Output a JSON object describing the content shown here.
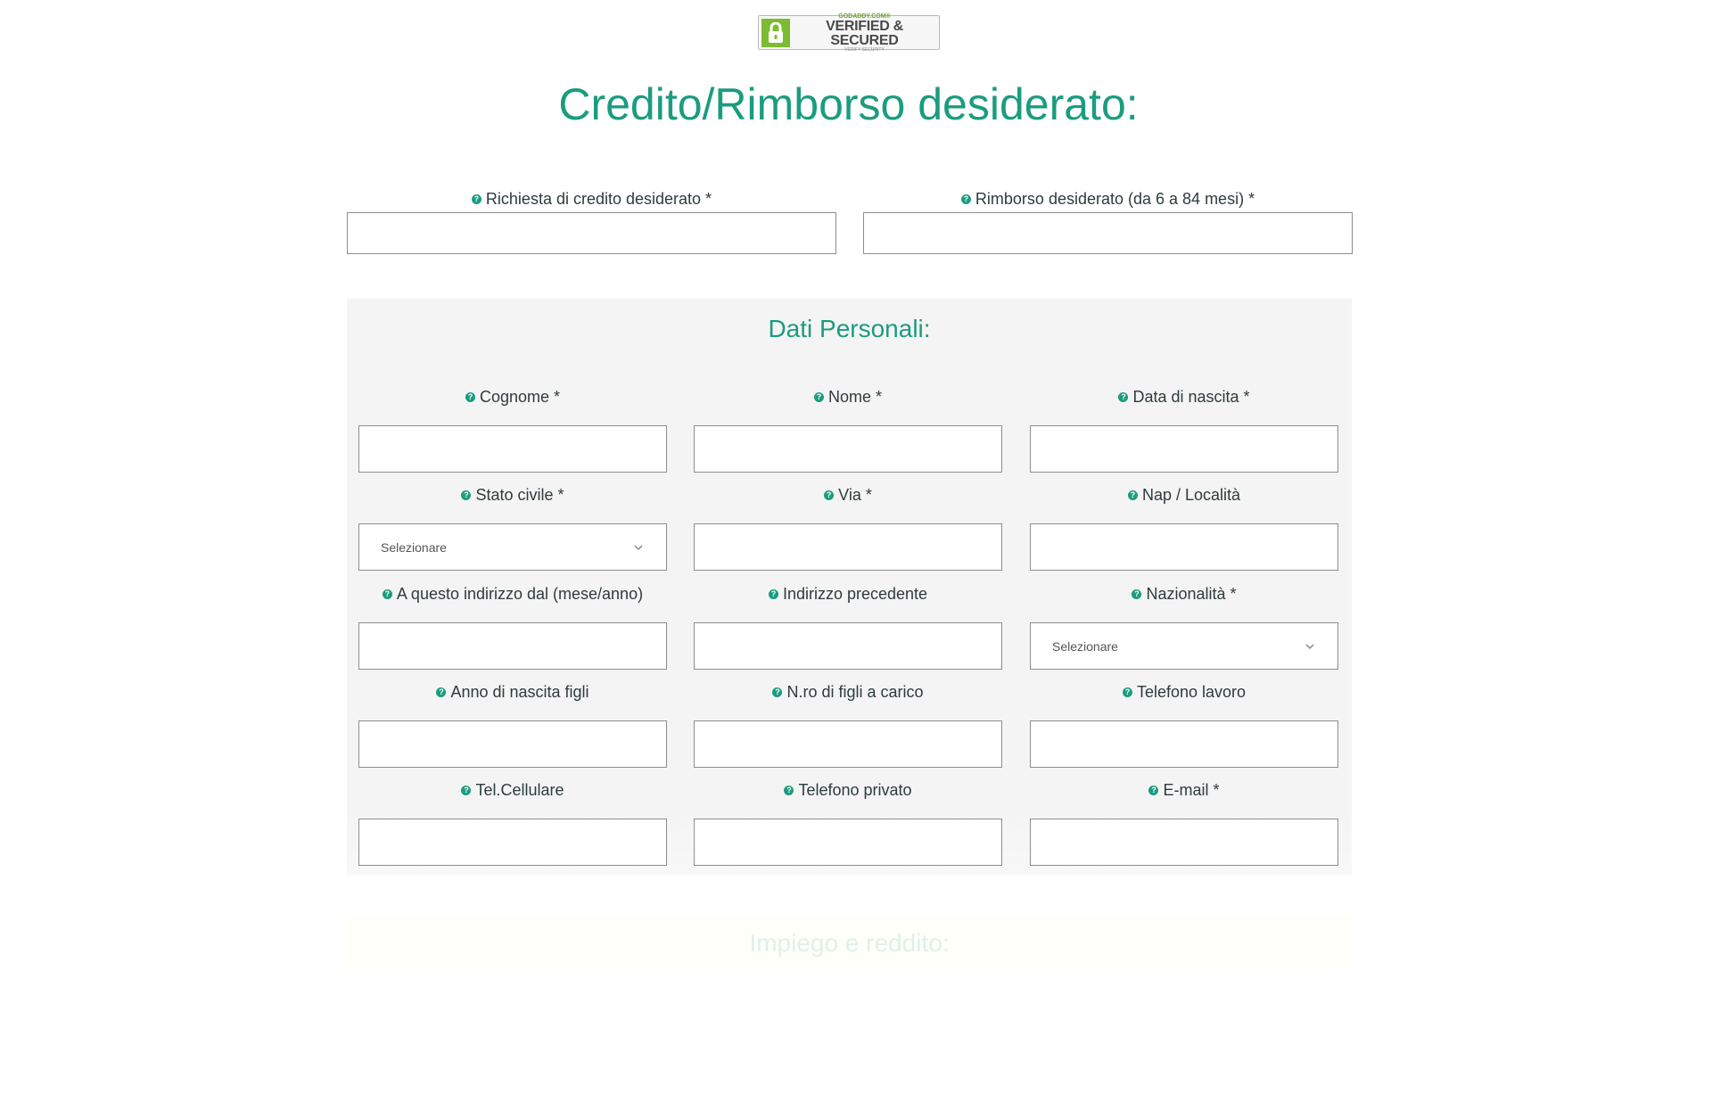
{
  "badge": {
    "small_top": "GODADDY.COM®",
    "main": "VERIFIED & SECURED",
    "small_bottom": "VERIFY SECURITY",
    "icon": "lock-icon"
  },
  "page_title": "Credito/Rimborso desiderato:",
  "top_fields": [
    {
      "label": "Richiesta di credito desiderato *",
      "value": ""
    },
    {
      "label": "Rimborso desiderato (da 6 a 84 mesi) *",
      "value": ""
    }
  ],
  "personal": {
    "title": "Dati Personali:",
    "fields": [
      {
        "label": "Cognome *",
        "type": "text",
        "value": ""
      },
      {
        "label": "Nome *",
        "type": "text",
        "value": ""
      },
      {
        "label": "Data di nascita *",
        "type": "text",
        "value": ""
      },
      {
        "label": "Stato civile *",
        "type": "select",
        "value": "Selezionare"
      },
      {
        "label": "Via *",
        "type": "text",
        "value": ""
      },
      {
        "label": "Nap / Località",
        "type": "text",
        "value": ""
      },
      {
        "label": "A questo indirizzo dal (mese/anno)",
        "type": "text",
        "value": ""
      },
      {
        "label": "Indirizzo precedente",
        "type": "text",
        "value": ""
      },
      {
        "label": "Nazionalità *",
        "type": "select",
        "value": "Selezionare"
      },
      {
        "label": "Anno di nascita figli",
        "type": "text",
        "value": ""
      },
      {
        "label": "N.ro di figli a carico",
        "type": "text",
        "value": ""
      },
      {
        "label": "Telefono lavoro",
        "type": "text",
        "value": ""
      },
      {
        "label": "Tel.Cellulare",
        "type": "text",
        "value": ""
      },
      {
        "label": "Telefono privato",
        "type": "text",
        "value": ""
      },
      {
        "label": "E-mail *",
        "type": "text",
        "value": ""
      }
    ]
  },
  "employment": {
    "title": "Impiego e reddito:"
  },
  "help_icon_glyph": "?",
  "colors": {
    "accent": "#1b9c7f",
    "panel_bg": "#f4f4f4",
    "input_border": "#8e8e8e"
  }
}
